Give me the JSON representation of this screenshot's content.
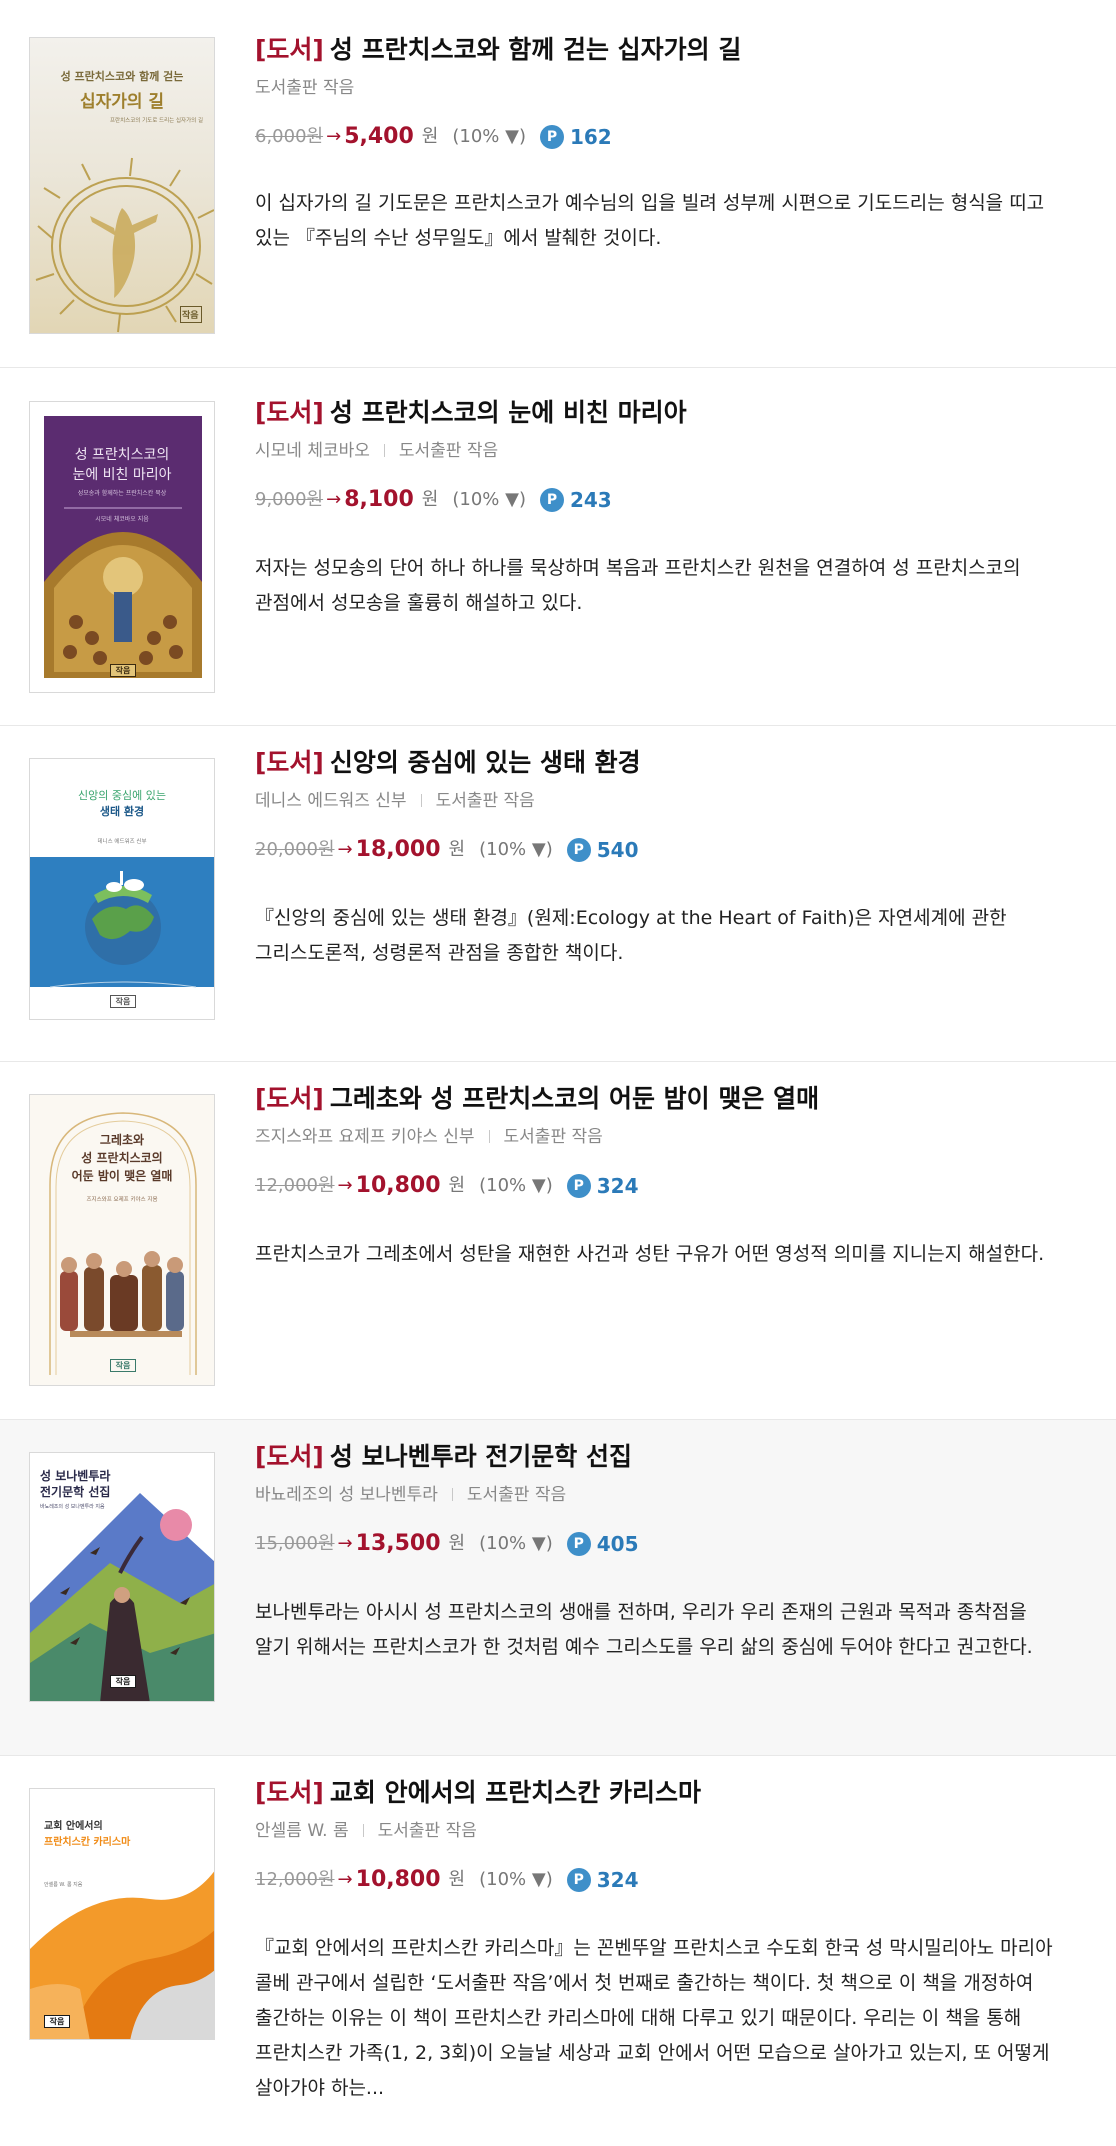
{
  "items": [
    {
      "category": "[도서]",
      "title": "성 프란치스코와 함께 걷는 십자가의 길",
      "author": "",
      "publisher": "도서출판 작음",
      "original_price": "6,000원",
      "arrow": "→",
      "sale_price": "5,400",
      "won": "원",
      "discount": "(10% ▼)",
      "points": "162",
      "description": "이 십자가의 길 기도문은 프란치스코가 예수님의 입을 빌려 성부께 시편으로 기도드리는 형식을 띠고 있는 『주님의 수난 성무일도』에서 발췌한 것이다.",
      "cover": {
        "line1": "성 프란치스코와 함께 걷는",
        "line2": "십자가의 길",
        "line3": "프란치스코의 기도로 드리는 십자가의 길",
        "publisher_mark": "작음"
      }
    },
    {
      "category": "[도서]",
      "title": "성 프란치스코의 눈에 비친 마리아",
      "author": "시모네 체코바오",
      "publisher": "도서출판 작음",
      "original_price": "9,000원",
      "arrow": "→",
      "sale_price": "8,100",
      "won": "원",
      "discount": "(10% ▼)",
      "points": "243",
      "description": "저자는 성모송의 단어 하나 하나를 묵상하며 복음과 프란치스칸 원천을 연결하여 성 프란치스코의 관점에서 성모송을 훌륭히 해설하고 있다.",
      "cover": {
        "line1": "성 프란치스코의",
        "line2": "눈에 비친 마리아",
        "line3": "성모송과 함께하는 프란치스칸 묵상",
        "line4": "시모네 체코바오 지음",
        "publisher_mark": "작음"
      }
    },
    {
      "category": "[도서]",
      "title": "신앙의 중심에 있는 생태 환경",
      "author": "데니스 에드워즈 신부",
      "publisher": "도서출판 작음",
      "original_price": "20,000원",
      "arrow": "→",
      "sale_price": "18,000",
      "won": "원",
      "discount": "(10% ▼)",
      "points": "540",
      "description": "『신앙의 중심에 있는 생태 환경』(원제:Ecology at the Heart of Faith)은 자연세계에 관한 그리스도론적, 성령론적 관점을 종합한 책이다.",
      "cover": {
        "line1": "신앙의 중심에 있는",
        "line2": "생태 환경",
        "line3": "데니스 에드워즈 신부",
        "publisher_mark": "작음"
      }
    },
    {
      "category": "[도서]",
      "title": "그레초와 성 프란치스코의 어둔 밤이 맺은 열매",
      "author": "즈지스와프 요제프 키야스 신부",
      "publisher": "도서출판 작음",
      "original_price": "12,000원",
      "arrow": "→",
      "sale_price": "10,800",
      "won": "원",
      "discount": "(10% ▼)",
      "points": "324",
      "description": "프란치스코가 그레초에서 성탄을 재현한 사건과 성탄 구유가 어떤 영성적 의미를 지니는지 해설한다.",
      "cover": {
        "line1": "그레초와",
        "line2": "성 프란치스코의",
        "line3": "어둔 밤이 맺은 열매",
        "line4": "즈지스와프 요제프 키야스 지음",
        "publisher_mark": "작음"
      }
    },
    {
      "category": "[도서]",
      "title": "성 보나벤투라 전기문학 선집",
      "author": "바뇨레조의 성 보나벤투라",
      "publisher": "도서출판 작음",
      "original_price": "15,000원",
      "arrow": "→",
      "sale_price": "13,500",
      "won": "원",
      "discount": "(10% ▼)",
      "points": "405",
      "description": "보나벤투라는 아시시 성 프란치스코의 생애를 전하며, 우리가 우리 존재의 근원과 목적과 종착점을 알기 위해서는 프란치스코가 한 것처럼 예수 그리스도를 우리 삶의 중심에 두어야 한다고 권고한다.",
      "cover": {
        "line1": "성 보나벤투라",
        "line2": "전기문학 선집",
        "line3": "바뇨레조의 성 보나벤투라 지음",
        "publisher_mark": "작음"
      }
    },
    {
      "category": "[도서]",
      "title": "교회 안에서의 프란치스칸 카리스마",
      "author": "안셀름 W. 롬",
      "publisher": "도서출판 작음",
      "original_price": "12,000원",
      "arrow": "→",
      "sale_price": "10,800",
      "won": "원",
      "discount": "(10% ▼)",
      "points": "324",
      "description": "『교회 안에서의 프란치스칸 카리스마』는 꼰벤뚜알 프란치스코 수도회 한국 성 막시밀리아노 마리아 콜베 관구에서 설립한 ‘도서출판 작음’에서 첫 번째로 출간하는 책이다. 첫 책으로 이 책을 개정하여 출간하는 이유는 이 책이 프란치스칸 카리스마에 대해 다루고 있기 때문이다. 우리는 이 책을 통해 프란치스칸 가족(1, 2, 3회)이 오늘날 세상과 교회 안에서 어떤 모습으로 살아가고 있는지, 또 어떻게 살아가야 하는...",
      "cover": {
        "line1": "교회 안에서의",
        "line2": "프란치스칸 카리스마",
        "line3": "안셀름 W. 롬 지음",
        "publisher_mark": "작음"
      }
    }
  ],
  "colors": {
    "category_red": "#a3122d",
    "sale_red": "#a3122d",
    "points_blue": "#2b7ab8",
    "highlight_row_bg": "#f7f7f7"
  },
  "icons": {
    "points": "point-p-icon"
  },
  "point_badge_letter": "P"
}
